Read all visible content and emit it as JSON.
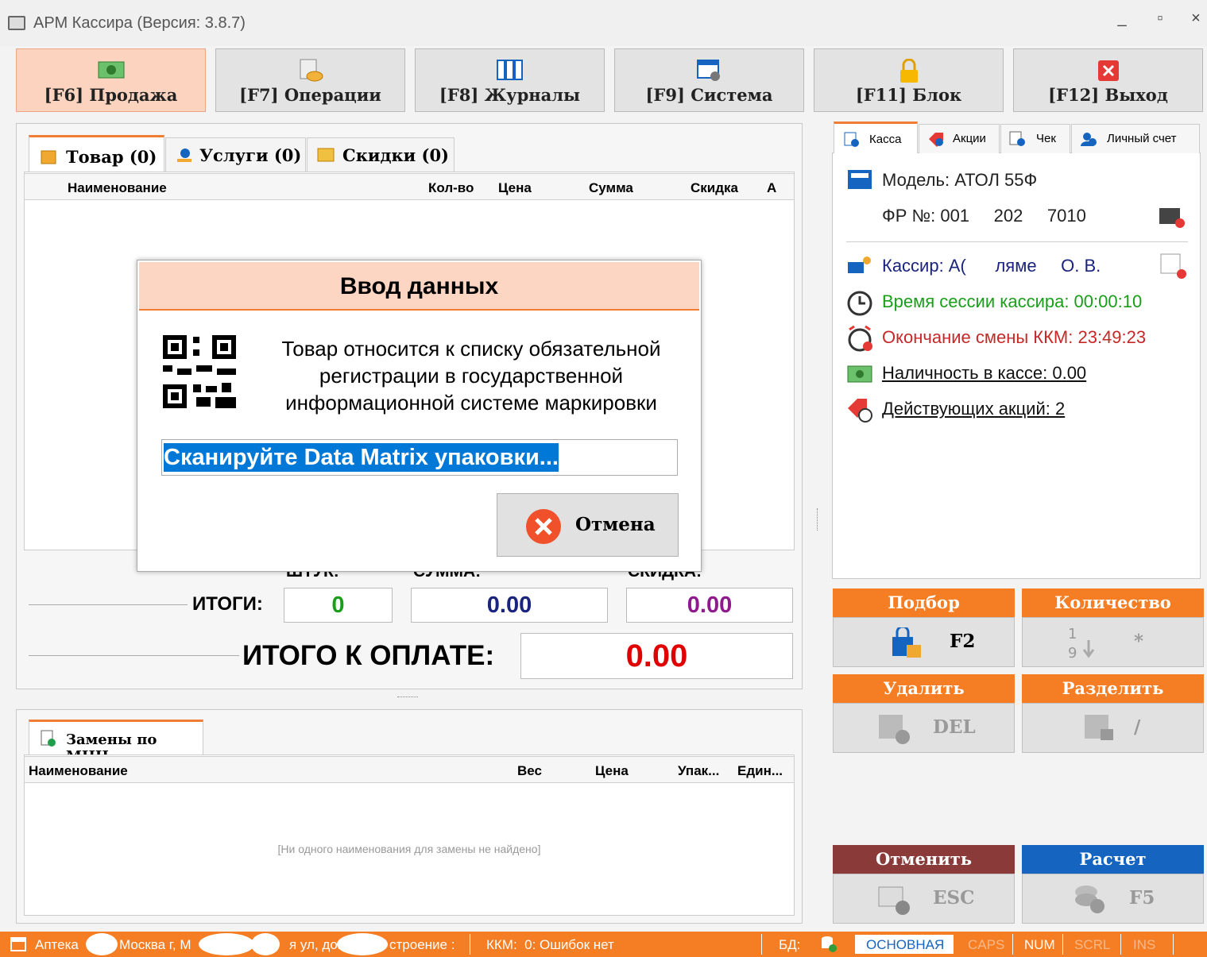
{
  "window": {
    "title": "АРМ Кассира (Версия: 3.8.7)",
    "min": "_",
    "max": "▫",
    "close": "×"
  },
  "toolbar": [
    {
      "label": "[F6] Продажа"
    },
    {
      "label": "[F7] Операции"
    },
    {
      "label": "[F8] Журналы"
    },
    {
      "label": "[F9] Система"
    },
    {
      "label": "[F11] Блок"
    },
    {
      "label": "[F12] Выход"
    }
  ],
  "tabs": {
    "goods": "Товар (0)",
    "services": "Услуги (0)",
    "discounts": "Скидки (0)"
  },
  "goods_grid": {
    "columns": [
      "Наименование",
      "Кол-во",
      "Цена",
      "Сумма",
      "Скидка",
      "А"
    ]
  },
  "totals": {
    "label": "ИТОГИ:",
    "qty_label": "ШТУК:",
    "sum_label": "СУММА:",
    "disc_label": "СКИДКА:",
    "qty": "0",
    "sum": "0.00",
    "discount": "0.00",
    "pay_label": "ИТОГО К ОПЛАТЕ:",
    "pay": "0.00"
  },
  "replace_panel": {
    "tab": "Замены по МНН",
    "columns": [
      "Наименование",
      "Вес",
      "Цена",
      "Упак...",
      "Един..."
    ],
    "empty": "[Ни одного наименования для замены не найдено]"
  },
  "right_tabs": [
    "Касса",
    "Акции",
    "Чек",
    "Личный счет"
  ],
  "kassa": {
    "model": "Модель: АТОЛ 55Ф",
    "fr": "ФР №: 001     202     7010",
    "cashier": "Кассир: А(      ляме     О. В.",
    "session": "Время сессии кассира: 00:00:10",
    "shift_end": "Окончание смены ККМ: 23:49:23",
    "cash": "Наличность в кассе: 0.00",
    "promos": "Действующих акций: 2"
  },
  "actions": [
    {
      "title": "Подбор",
      "key": "F2",
      "color": "#f57d23"
    },
    {
      "title": "Количество",
      "key": "*",
      "color": "#f57d23"
    },
    {
      "title": "Удалить",
      "key": "DEL",
      "color": "#f57d23"
    },
    {
      "title": "Разделить",
      "key": "/",
      "color": "#f57d23"
    },
    {
      "title": "Отменить",
      "key": "ESC",
      "color": "#8b3a3a"
    },
    {
      "title": "Расчет",
      "key": "F5",
      "color": "#1565c0"
    }
  ],
  "dialog": {
    "title": "Ввод данных",
    "message": [
      "Товар относится к списку обязательной",
      "регистрации в государственной",
      "информационной системе маркировки"
    ],
    "input_value": "Сканируйте Data Matrix упаковки...",
    "cancel": "Отмена"
  },
  "status": {
    "pharmacy": "Аптека",
    "address1": "Москва г, М",
    "address2": "я ул, дом",
    "address3": "строение :",
    "kkm": "ККМ:  0: Ошибок нет",
    "db": "БД:",
    "db_name": "ОСНОВНАЯ",
    "caps": "CAPS",
    "num": "NUM",
    "scrl": "SCRL",
    "ins": "INS"
  },
  "colors": {
    "accent": "#f57d23",
    "green": "#1a9e1a",
    "red": "#c62828",
    "navy": "#1a237e",
    "purple": "#8e1a8e",
    "pay_red": "#e00000",
    "selection": "#0078d7"
  }
}
